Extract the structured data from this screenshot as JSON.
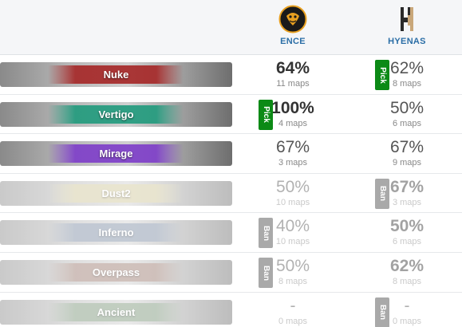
{
  "teams": {
    "ence": {
      "name": "ENCE",
      "logo": "ence-logo"
    },
    "hyenas": {
      "name": "HYENAS",
      "logo": "hyenas-logo"
    }
  },
  "maps": [
    {
      "name": "Nuke",
      "color": "#a52525",
      "ence": {
        "pct": "64%",
        "maps": "11 maps"
      },
      "hyenas": {
        "pct": "62%",
        "maps": "8 maps"
      },
      "tag": {
        "label": "Pick",
        "type": "pick",
        "side": "hyenas"
      },
      "faded": false
    },
    {
      "name": "Vertigo",
      "color": "#1f9a7c",
      "ence": {
        "pct": "100%",
        "maps": "4 maps"
      },
      "hyenas": {
        "pct": "50%",
        "maps": "6 maps"
      },
      "tag": {
        "label": "Pick",
        "type": "pick",
        "side": "ence"
      },
      "faded": false
    },
    {
      "name": "Mirage",
      "color": "#7d3cc9",
      "ence": {
        "pct": "67%",
        "maps": "3 maps"
      },
      "hyenas": {
        "pct": "67%",
        "maps": "9 maps"
      },
      "tag": null,
      "faded": false
    },
    {
      "name": "Dust2",
      "color": "#e0c84a",
      "ence": {
        "pct": "50%",
        "maps": "10 maps"
      },
      "hyenas": {
        "pct": "67%",
        "maps": "3 maps"
      },
      "tag": {
        "label": "Ban",
        "type": "ban",
        "side": "hyenas"
      },
      "faded": true
    },
    {
      "name": "Inferno",
      "color": "#5a87c8",
      "ence": {
        "pct": "40%",
        "maps": "10 maps"
      },
      "hyenas": {
        "pct": "50%",
        "maps": "6 maps"
      },
      "tag": {
        "label": "Ban",
        "type": "ban",
        "side": "ence"
      },
      "faded": true
    },
    {
      "name": "Overpass",
      "color": "#c06545",
      "ence": {
        "pct": "50%",
        "maps": "8 maps"
      },
      "hyenas": {
        "pct": "62%",
        "maps": "8 maps"
      },
      "tag": {
        "label": "Ban",
        "type": "ban",
        "side": "ence"
      },
      "faded": true
    },
    {
      "name": "Ancient",
      "color": "#4f9a4a",
      "ence": {
        "pct": "-",
        "maps": "0 maps"
      },
      "hyenas": {
        "pct": "-",
        "maps": "0 maps"
      },
      "tag": {
        "label": "Ban",
        "type": "ban",
        "side": "hyenas"
      },
      "faded": true
    }
  ]
}
